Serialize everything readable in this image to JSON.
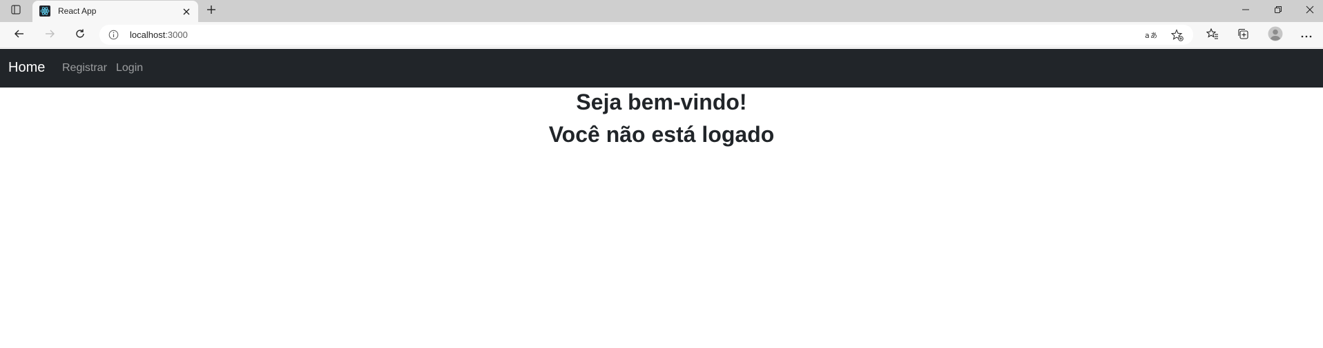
{
  "browser": {
    "tab": {
      "title": "React App"
    },
    "address": {
      "host": "localhost",
      "port": ":3000"
    }
  },
  "navbar": {
    "brand": "Home",
    "links": [
      {
        "label": "Registrar"
      },
      {
        "label": "Login"
      }
    ],
    "background": "#212529"
  },
  "main": {
    "welcome": "Seja bem-vindo!",
    "status": "Você não está logado"
  },
  "icons": {
    "tab_actions": "tab-actions-icon",
    "favicon": "react-icon",
    "tab_close": "close-icon",
    "new_tab": "plus-icon",
    "back": "arrow-left-icon",
    "forward": "arrow-right-icon",
    "refresh": "refresh-icon",
    "info": "info-icon",
    "translate": "translate-icon",
    "favorite": "star-add-icon",
    "favorites": "favorites-icon",
    "collections": "collections-icon",
    "profile": "profile-icon",
    "more": "more-icon"
  }
}
